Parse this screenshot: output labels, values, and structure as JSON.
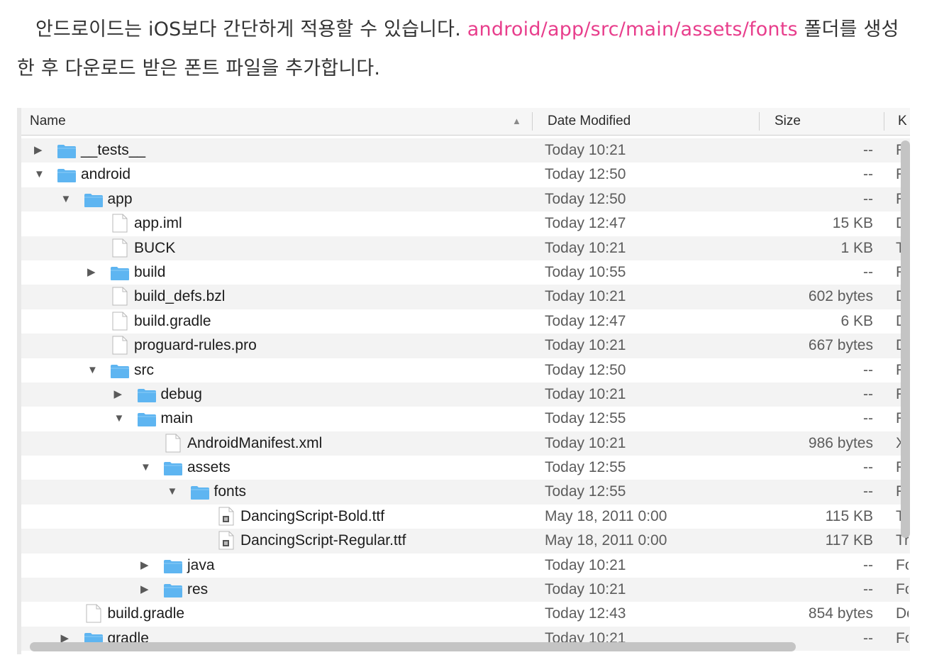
{
  "intro": {
    "text_before": "안드로이드는 iOS보다 간단하게 적용할 수 있습니다.",
    "code_path": "android/app/src/main/assets/fonts",
    "text_after": "폴더를 생성한 후 다운로드 받은 폰트 파일을 추가합니다."
  },
  "finder": {
    "columns": {
      "name": "Name",
      "date": "Date Modified",
      "size": "Size",
      "kind": "K"
    },
    "rows": [
      {
        "name": "__tests__",
        "date": "Today 10:21",
        "size": "--",
        "kind": "Fo",
        "type": "folder",
        "depth": 0,
        "toggle": "collapsed"
      },
      {
        "name": "android",
        "date": "Today 12:50",
        "size": "--",
        "kind": "Fo",
        "type": "folder",
        "depth": 0,
        "toggle": "expanded"
      },
      {
        "name": "app",
        "date": "Today 12:50",
        "size": "--",
        "kind": "Fo",
        "type": "folder",
        "depth": 1,
        "toggle": "expanded"
      },
      {
        "name": "app.iml",
        "date": "Today 12:47",
        "size": "15 KB",
        "kind": "Do",
        "type": "file",
        "depth": 2,
        "toggle": "none"
      },
      {
        "name": "BUCK",
        "date": "Today 10:21",
        "size": "1 KB",
        "kind": "Te",
        "type": "file",
        "depth": 2,
        "toggle": "none"
      },
      {
        "name": "build",
        "date": "Today 10:55",
        "size": "--",
        "kind": "Fo",
        "type": "folder",
        "depth": 2,
        "toggle": "collapsed"
      },
      {
        "name": "build_defs.bzl",
        "date": "Today 10:21",
        "size": "602 bytes",
        "kind": "Do",
        "type": "file",
        "depth": 2,
        "toggle": "none"
      },
      {
        "name": "build.gradle",
        "date": "Today 12:47",
        "size": "6 KB",
        "kind": "Do",
        "type": "file",
        "depth": 2,
        "toggle": "none"
      },
      {
        "name": "proguard-rules.pro",
        "date": "Today 10:21",
        "size": "667 bytes",
        "kind": "Do",
        "type": "file",
        "depth": 2,
        "toggle": "none"
      },
      {
        "name": "src",
        "date": "Today 12:50",
        "size": "--",
        "kind": "Fo",
        "type": "folder",
        "depth": 2,
        "toggle": "expanded"
      },
      {
        "name": "debug",
        "date": "Today 10:21",
        "size": "--",
        "kind": "Fo",
        "type": "folder",
        "depth": 3,
        "toggle": "collapsed"
      },
      {
        "name": "main",
        "date": "Today 12:55",
        "size": "--",
        "kind": "Fo",
        "type": "folder",
        "depth": 3,
        "toggle": "expanded"
      },
      {
        "name": "AndroidManifest.xml",
        "date": "Today 10:21",
        "size": "986 bytes",
        "kind": "XM",
        "type": "file",
        "depth": 4,
        "toggle": "none"
      },
      {
        "name": "assets",
        "date": "Today 12:55",
        "size": "--",
        "kind": "Fo",
        "type": "folder",
        "depth": 4,
        "toggle": "expanded"
      },
      {
        "name": "fonts",
        "date": "Today 12:55",
        "size": "--",
        "kind": "Fo",
        "type": "folder",
        "depth": 5,
        "toggle": "expanded"
      },
      {
        "name": "DancingScript-Bold.ttf",
        "date": "May 18, 2011 0:00",
        "size": "115 KB",
        "kind": "Tr",
        "type": "font",
        "depth": 6,
        "toggle": "none"
      },
      {
        "name": "DancingScript-Regular.ttf",
        "date": "May 18, 2011 0:00",
        "size": "117 KB",
        "kind": "Tr",
        "type": "font",
        "depth": 6,
        "toggle": "none"
      },
      {
        "name": "java",
        "date": "Today 10:21",
        "size": "--",
        "kind": "Fo",
        "type": "folder",
        "depth": 4,
        "toggle": "collapsed"
      },
      {
        "name": "res",
        "date": "Today 10:21",
        "size": "--",
        "kind": "Fo",
        "type": "folder",
        "depth": 4,
        "toggle": "collapsed"
      },
      {
        "name": "build.gradle",
        "date": "Today 12:43",
        "size": "854 bytes",
        "kind": "Do",
        "type": "file",
        "depth": 1,
        "toggle": "none"
      },
      {
        "name": "gradle",
        "date": "Today 10:21",
        "size": "--",
        "kind": "Fo",
        "type": "folder",
        "depth": 1,
        "toggle": "collapsed"
      }
    ]
  },
  "colors": {
    "folder_blue": "#5eb5f1",
    "code_pink": "#e83e8c",
    "row_stripe": "#f3f3f3"
  }
}
